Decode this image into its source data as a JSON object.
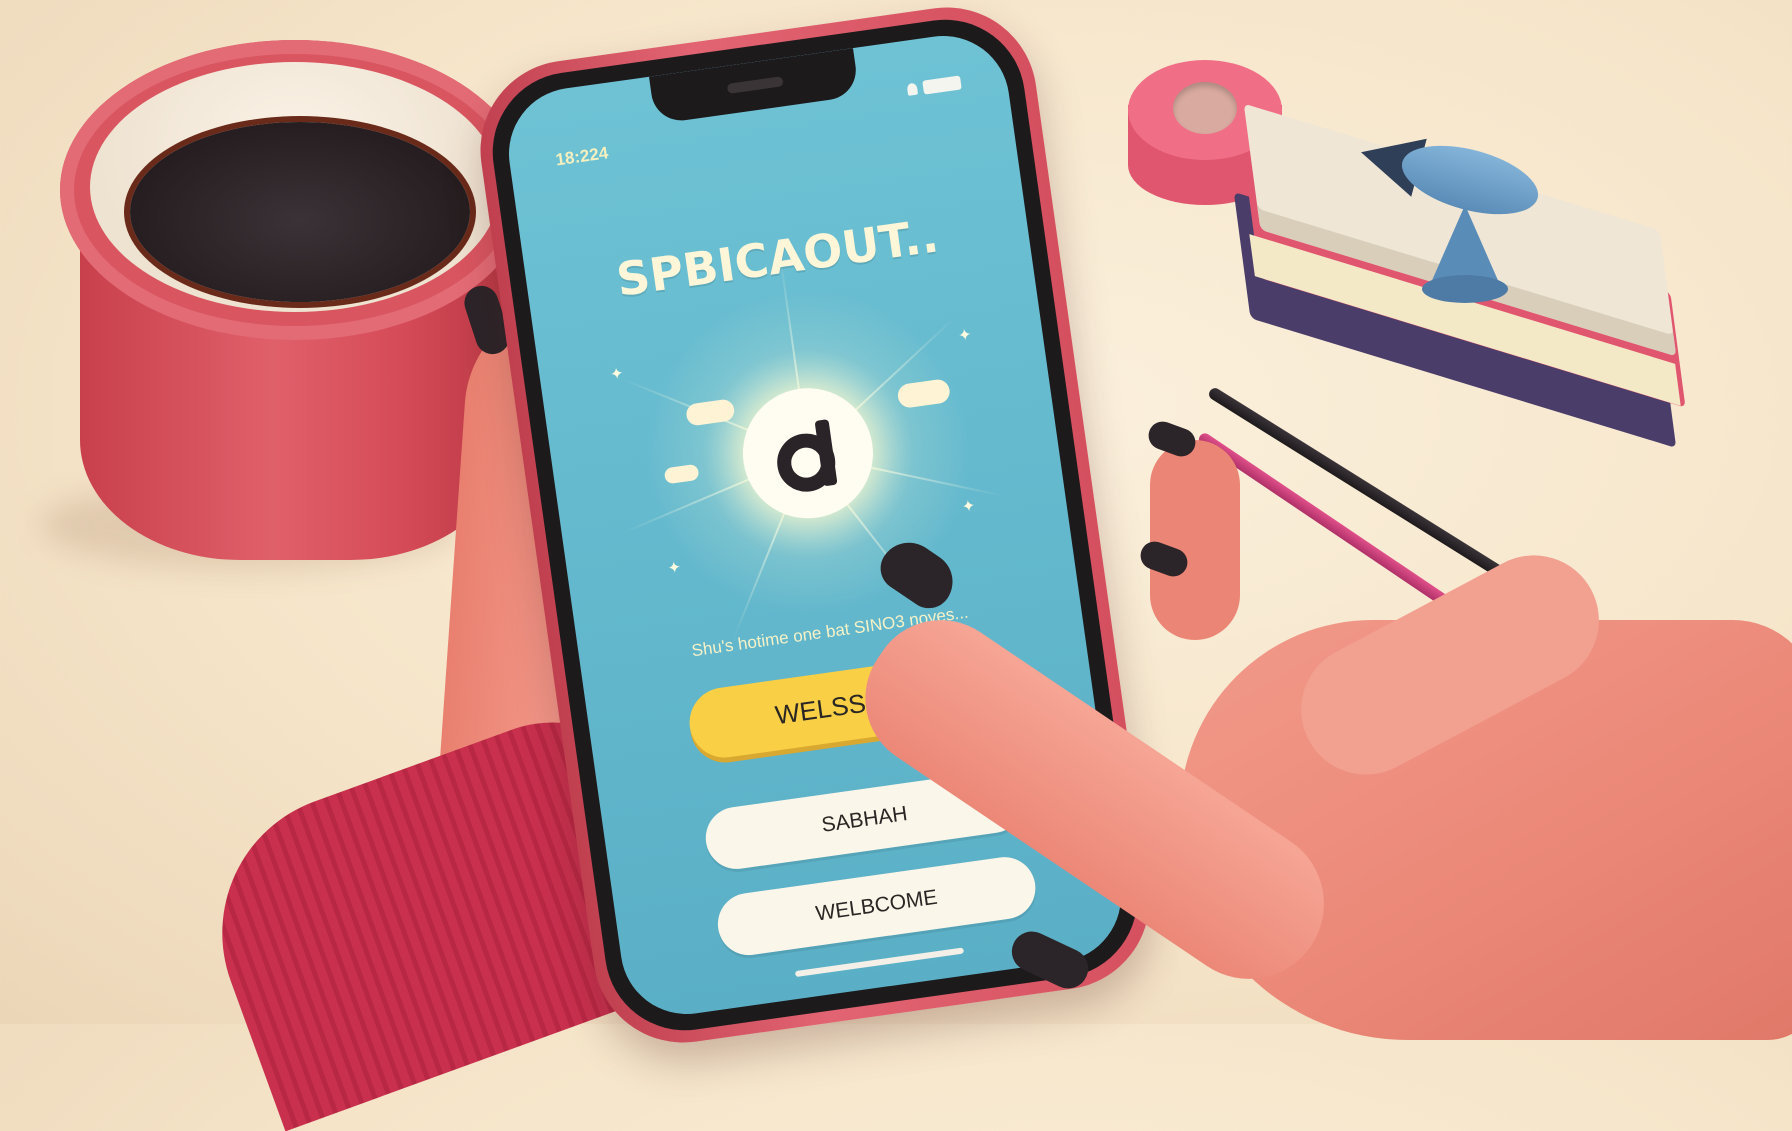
{
  "status_bar": {
    "time": "18:224"
  },
  "app": {
    "title": "SPBICAOUT..",
    "tagline": "Shu's hotime one bat SINO3 noves...",
    "buttons": {
      "primary": "WELSSORE",
      "secondary_1": "SABHAH",
      "secondary_2": "WELBCOME"
    }
  },
  "colors": {
    "screen": "#62b7cc",
    "primary_button": "#f8cf45",
    "secondary_button": "#fbf6ea",
    "phone_case": "#d5505f"
  }
}
